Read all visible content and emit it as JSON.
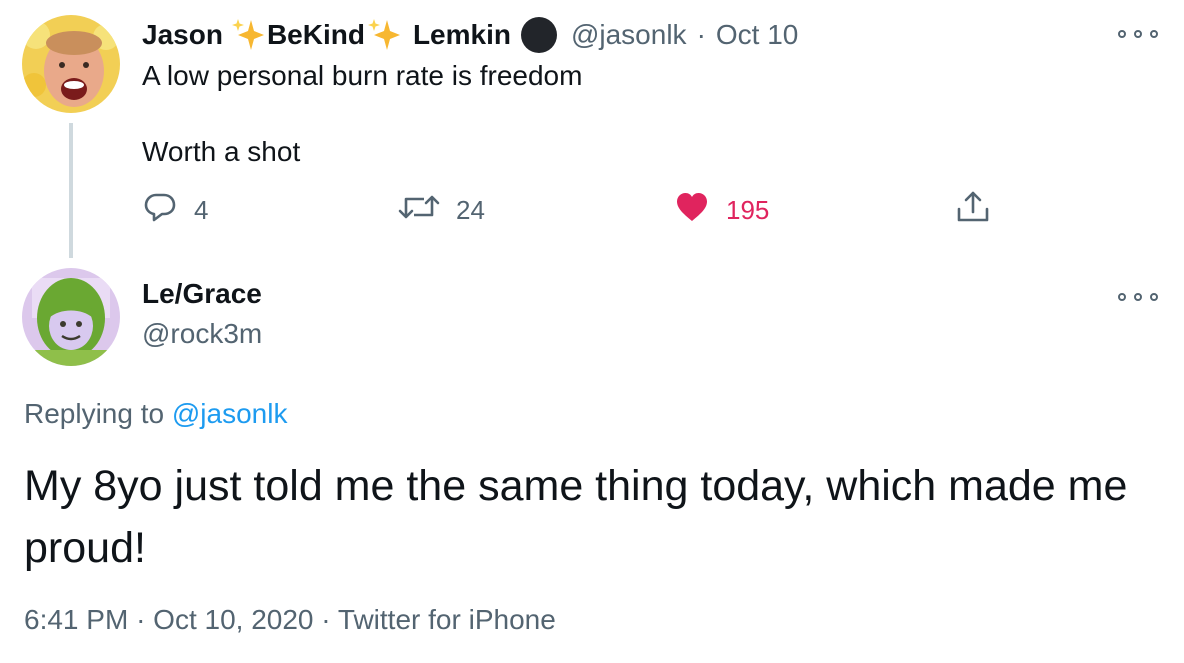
{
  "parent_tweet": {
    "display_name_parts": [
      "Jason",
      "BeKind",
      "Lemkin"
    ],
    "handle": "@jasonlk",
    "separator": "·",
    "date": "Oct 10",
    "text_line_1": "A low personal burn rate is freedom",
    "text_line_2": "Worth a shot",
    "actions": {
      "reply_count": "4",
      "retweet_count": "24",
      "like_count": "195"
    },
    "emoji_icons": [
      "sparkles-icon",
      "sparkles-icon",
      "black-circle-icon"
    ]
  },
  "reply_tweet": {
    "display_name": "Le/Grace",
    "handle": "@rock3m",
    "replying_prefix": "Replying to",
    "replying_mention": "@jasonlk",
    "text": "My 8yo just told me the same thing today, which made me proud!",
    "time": "6:41 PM",
    "separator": "·",
    "date": "Oct 10, 2020",
    "source": "Twitter for iPhone"
  },
  "colors": {
    "text_primary": "#0f1419",
    "text_muted": "#536471",
    "mention": "#1d9bf0",
    "like": "#e0245e",
    "thread_line": "#cfd9de"
  }
}
